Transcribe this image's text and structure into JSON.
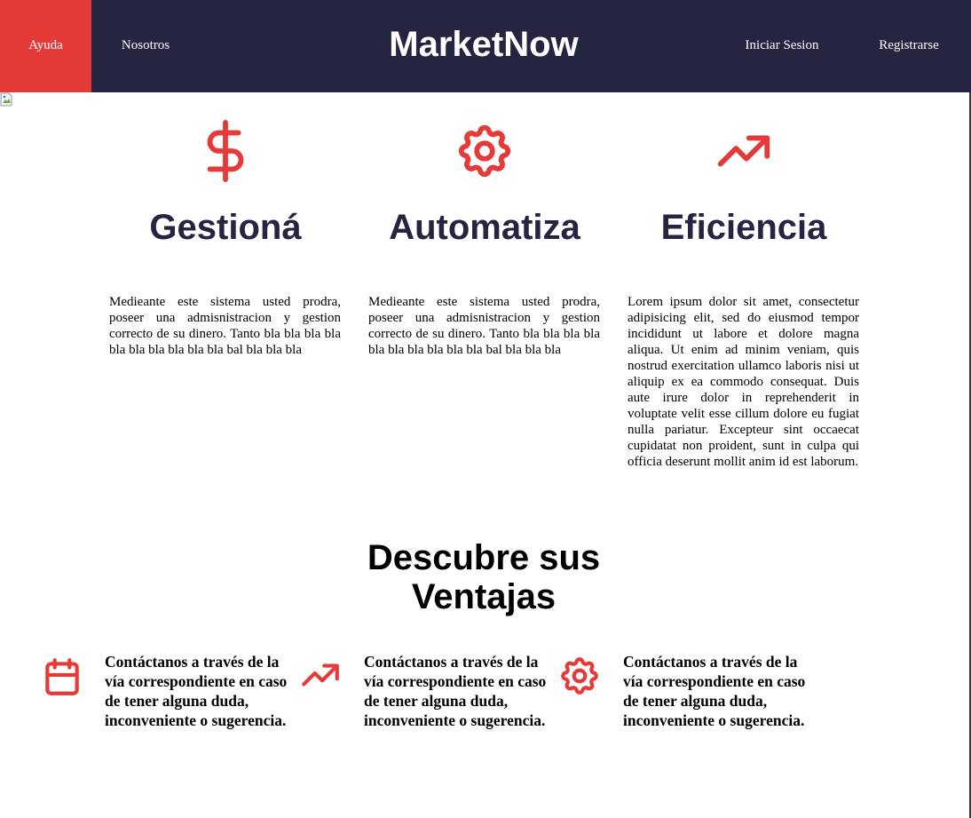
{
  "nav": {
    "help": "Ayuda",
    "about": "Nosotros",
    "brand": "MarketNow",
    "login": "Iniciar Sesion",
    "register": "Registrarse"
  },
  "colors": {
    "navbar": "#252441",
    "accent": "#e63a38",
    "heading": "#252441"
  },
  "features": [
    {
      "icon": "dollar-icon",
      "title": "Gestioná",
      "text": "Medieante este sistema usted prodra, poseer una admisnistracion y gestion correcto de su dinero. Tanto bla bla bla bla bla bla bla bla bla bla bal bla bla bla"
    },
    {
      "icon": "gear-icon",
      "title": "Automatiza",
      "text": "Medieante este sistema usted prodra, poseer una admisnistracion y gestion correcto de su dinero. Tanto bla bla bla bla bla bla bla bla bla bla bal bla bla bla"
    },
    {
      "icon": "trending-up-icon",
      "title": "Eficiencia",
      "text": "Lorem ipsum dolor sit amet, consectetur adipisicing elit, sed do eiusmod tempor incididunt ut labore et dolore magna aliqua. Ut enim ad minim veniam, quis nostrud exercitation ullamco laboris nisi ut aliquip ex ea commodo consequat. Duis aute irure dolor in reprehenderit in voluptate velit esse cillum dolore eu fugiat nulla pariatur. Excepteur sint occaecat cupidatat non proident, sunt in culpa qui officia deserunt mollit anim id est laborum."
    }
  ],
  "advantages": {
    "title": "Descubre sus Ventajas",
    "items": [
      {
        "icon": "calendar-icon",
        "text": "Contáctanos a través de la vía correspondiente en caso de tener alguna duda, inconveniente o sugerencia."
      },
      {
        "icon": "trending-up-icon",
        "text": "Contáctanos a través de la vía correspondiente en caso de tener alguna duda, inconveniente o sugerencia."
      },
      {
        "icon": "gear-icon",
        "text": "Contáctanos a través de la vía correspondiente en caso de tener alguna duda, inconveniente o sugerencia."
      }
    ]
  }
}
